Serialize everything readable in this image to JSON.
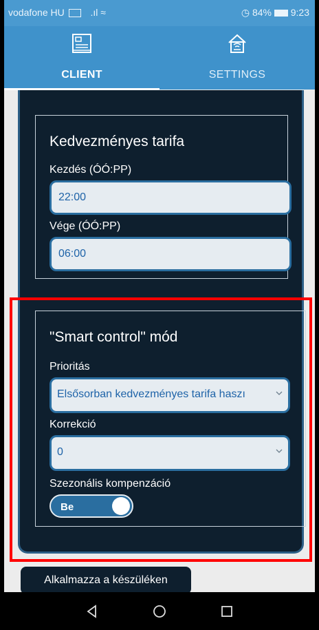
{
  "status_bar": {
    "carrier": "vodafone HU",
    "right_text": "84%",
    "time": "9:23"
  },
  "tabs": [
    {
      "label": "CLIENT",
      "icon": "client-panel-icon",
      "active": true
    },
    {
      "label": "SETTINGS",
      "icon": "home-wifi-icon",
      "active": false
    }
  ],
  "tariff_card": {
    "title": "Kedvezményes tarifa",
    "start_label": "Kezdés (ÓÓ:PP)",
    "start_value": "22:00",
    "end_label": "Vége (ÓÓ:PP)",
    "end_value": "06:00"
  },
  "smart_card": {
    "title": "\"Smart control\" mód",
    "priority_label": "Prioritás",
    "priority_value": "Elsősorban kedvezményes tarifa haszı",
    "correction_label": "Korrekció",
    "correction_value": "0",
    "seasonal_label": "Szezonális kompenzáció",
    "seasonal_toggle": "Be"
  },
  "apply_button": "Alkalmazza a készüléken",
  "colors": {
    "accent": "#3f92cb",
    "panel": "#0e1f2e",
    "highlight": "#ff0000"
  }
}
